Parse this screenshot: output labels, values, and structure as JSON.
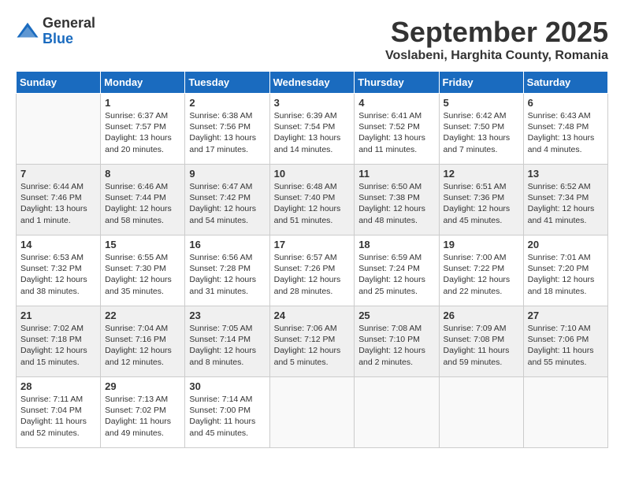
{
  "logo": {
    "general": "General",
    "blue": "Blue"
  },
  "title": "September 2025",
  "location": "Voslabeni, Harghita County, Romania",
  "days_header": [
    "Sunday",
    "Monday",
    "Tuesday",
    "Wednesday",
    "Thursday",
    "Friday",
    "Saturday"
  ],
  "weeks": [
    [
      {
        "day": "",
        "content": ""
      },
      {
        "day": "1",
        "content": "Sunrise: 6:37 AM\nSunset: 7:57 PM\nDaylight: 13 hours\nand 20 minutes."
      },
      {
        "day": "2",
        "content": "Sunrise: 6:38 AM\nSunset: 7:56 PM\nDaylight: 13 hours\nand 17 minutes."
      },
      {
        "day": "3",
        "content": "Sunrise: 6:39 AM\nSunset: 7:54 PM\nDaylight: 13 hours\nand 14 minutes."
      },
      {
        "day": "4",
        "content": "Sunrise: 6:41 AM\nSunset: 7:52 PM\nDaylight: 13 hours\nand 11 minutes."
      },
      {
        "day": "5",
        "content": "Sunrise: 6:42 AM\nSunset: 7:50 PM\nDaylight: 13 hours\nand 7 minutes."
      },
      {
        "day": "6",
        "content": "Sunrise: 6:43 AM\nSunset: 7:48 PM\nDaylight: 13 hours\nand 4 minutes."
      }
    ],
    [
      {
        "day": "7",
        "content": "Sunrise: 6:44 AM\nSunset: 7:46 PM\nDaylight: 13 hours\nand 1 minute."
      },
      {
        "day": "8",
        "content": "Sunrise: 6:46 AM\nSunset: 7:44 PM\nDaylight: 12 hours\nand 58 minutes."
      },
      {
        "day": "9",
        "content": "Sunrise: 6:47 AM\nSunset: 7:42 PM\nDaylight: 12 hours\nand 54 minutes."
      },
      {
        "day": "10",
        "content": "Sunrise: 6:48 AM\nSunset: 7:40 PM\nDaylight: 12 hours\nand 51 minutes."
      },
      {
        "day": "11",
        "content": "Sunrise: 6:50 AM\nSunset: 7:38 PM\nDaylight: 12 hours\nand 48 minutes."
      },
      {
        "day": "12",
        "content": "Sunrise: 6:51 AM\nSunset: 7:36 PM\nDaylight: 12 hours\nand 45 minutes."
      },
      {
        "day": "13",
        "content": "Sunrise: 6:52 AM\nSunset: 7:34 PM\nDaylight: 12 hours\nand 41 minutes."
      }
    ],
    [
      {
        "day": "14",
        "content": "Sunrise: 6:53 AM\nSunset: 7:32 PM\nDaylight: 12 hours\nand 38 minutes."
      },
      {
        "day": "15",
        "content": "Sunrise: 6:55 AM\nSunset: 7:30 PM\nDaylight: 12 hours\nand 35 minutes."
      },
      {
        "day": "16",
        "content": "Sunrise: 6:56 AM\nSunset: 7:28 PM\nDaylight: 12 hours\nand 31 minutes."
      },
      {
        "day": "17",
        "content": "Sunrise: 6:57 AM\nSunset: 7:26 PM\nDaylight: 12 hours\nand 28 minutes."
      },
      {
        "day": "18",
        "content": "Sunrise: 6:59 AM\nSunset: 7:24 PM\nDaylight: 12 hours\nand 25 minutes."
      },
      {
        "day": "19",
        "content": "Sunrise: 7:00 AM\nSunset: 7:22 PM\nDaylight: 12 hours\nand 22 minutes."
      },
      {
        "day": "20",
        "content": "Sunrise: 7:01 AM\nSunset: 7:20 PM\nDaylight: 12 hours\nand 18 minutes."
      }
    ],
    [
      {
        "day": "21",
        "content": "Sunrise: 7:02 AM\nSunset: 7:18 PM\nDaylight: 12 hours\nand 15 minutes."
      },
      {
        "day": "22",
        "content": "Sunrise: 7:04 AM\nSunset: 7:16 PM\nDaylight: 12 hours\nand 12 minutes."
      },
      {
        "day": "23",
        "content": "Sunrise: 7:05 AM\nSunset: 7:14 PM\nDaylight: 12 hours\nand 8 minutes."
      },
      {
        "day": "24",
        "content": "Sunrise: 7:06 AM\nSunset: 7:12 PM\nDaylight: 12 hours\nand 5 minutes."
      },
      {
        "day": "25",
        "content": "Sunrise: 7:08 AM\nSunset: 7:10 PM\nDaylight: 12 hours\nand 2 minutes."
      },
      {
        "day": "26",
        "content": "Sunrise: 7:09 AM\nSunset: 7:08 PM\nDaylight: 11 hours\nand 59 minutes."
      },
      {
        "day": "27",
        "content": "Sunrise: 7:10 AM\nSunset: 7:06 PM\nDaylight: 11 hours\nand 55 minutes."
      }
    ],
    [
      {
        "day": "28",
        "content": "Sunrise: 7:11 AM\nSunset: 7:04 PM\nDaylight: 11 hours\nand 52 minutes."
      },
      {
        "day": "29",
        "content": "Sunrise: 7:13 AM\nSunset: 7:02 PM\nDaylight: 11 hours\nand 49 minutes."
      },
      {
        "day": "30",
        "content": "Sunrise: 7:14 AM\nSunset: 7:00 PM\nDaylight: 11 hours\nand 45 minutes."
      },
      {
        "day": "",
        "content": ""
      },
      {
        "day": "",
        "content": ""
      },
      {
        "day": "",
        "content": ""
      },
      {
        "day": "",
        "content": ""
      }
    ]
  ]
}
